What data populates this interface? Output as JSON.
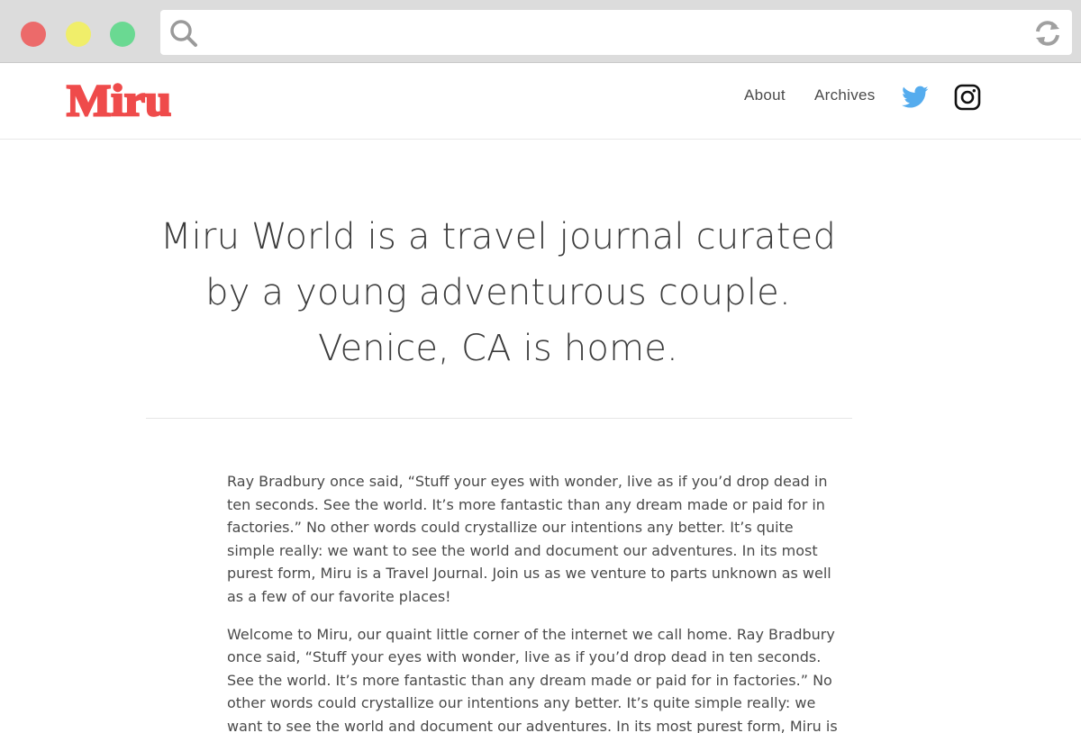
{
  "browser": {
    "search_icon": "search-icon",
    "reload_icon": "reload-icon",
    "url_value": ""
  },
  "header": {
    "logo_text": "Miru",
    "brand_color": "#ef4b4b",
    "nav": [
      {
        "label": "About"
      },
      {
        "label": "Archives"
      }
    ],
    "twitter_icon": "twitter-icon",
    "twitter_color": "#55acee",
    "instagram_icon": "instagram-icon"
  },
  "hero": {
    "lines": [
      "Miru World is a travel journal curated",
      "by a young adventurous couple.",
      "Venice, CA is home."
    ]
  },
  "content": {
    "paragraphs": [
      {
        "lines": [
          "Ray Bradbury once said, “Stuff your eyes with wonder, live as if you’d drop dead in",
          "ten seconds. See the world. It’s more fantastic than any dream made or paid for in",
          "factories.” No other words could crystallize our intentions any better. It’s quite",
          "simple really: we want to see the world and document our adventures. In its most",
          "purest form, Miru is a Travel Journal. Join us as we venture to parts unknown as well",
          "as a few of our favorite places!"
        ]
      },
      {
        "lines": [
          "Welcome to Miru, our quaint little corner of the internet we call home. Ray Bradbury",
          "once said, “Stuff your eyes with wonder, live as if you’d drop dead in ten seconds.",
          "See the world. It’s more fantastic than any dream made or paid for in factories.” No",
          "other words could crystallize our intentions any better. It’s quite simple really: we",
          "want to see the world and document our adventures. In its most purest form, Miru is"
        ]
      }
    ]
  }
}
